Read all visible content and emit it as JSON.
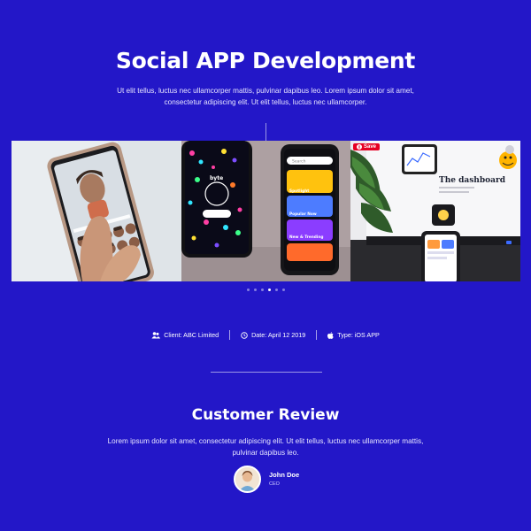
{
  "hero": {
    "title": "Social APP Development",
    "subtitle": "Ut elit tellus, luctus nec ullamcorper mattis, pulvinar dapibus leo. Lorem ipsum dolor sit amet, consectetur adipiscing elit. Ut elit tellus, luctus nec ullamcorper."
  },
  "gallery": {
    "slide2": {
      "byte_label": "byte",
      "search_placeholder": "Search",
      "cards": [
        "Spotlight",
        "Popular Now",
        "New & Trending"
      ]
    },
    "slide3": {
      "save_label": "Save",
      "headline": "The dashboard"
    },
    "dots": {
      "count": 6,
      "active_index": 3
    }
  },
  "meta": {
    "client": "Client: ABC Limited",
    "date": "Date: April 12 2019",
    "type": "Type: iOS APP"
  },
  "review": {
    "title": "Customer Review",
    "text": "Lorem ipsum dolor sit amet, consectetur adipiscing elit. Ut elit tellus, luctus nec ullamcorper mattis, pulvinar dapibus leo.",
    "author_name": "John Doe",
    "author_role": "CEO"
  },
  "colors": {
    "background": "#2317c8",
    "text": "#ffffff",
    "pinterest_red": "#e60023"
  },
  "icons": {
    "client": "users-icon",
    "date": "clock-icon",
    "type": "apple-icon"
  }
}
